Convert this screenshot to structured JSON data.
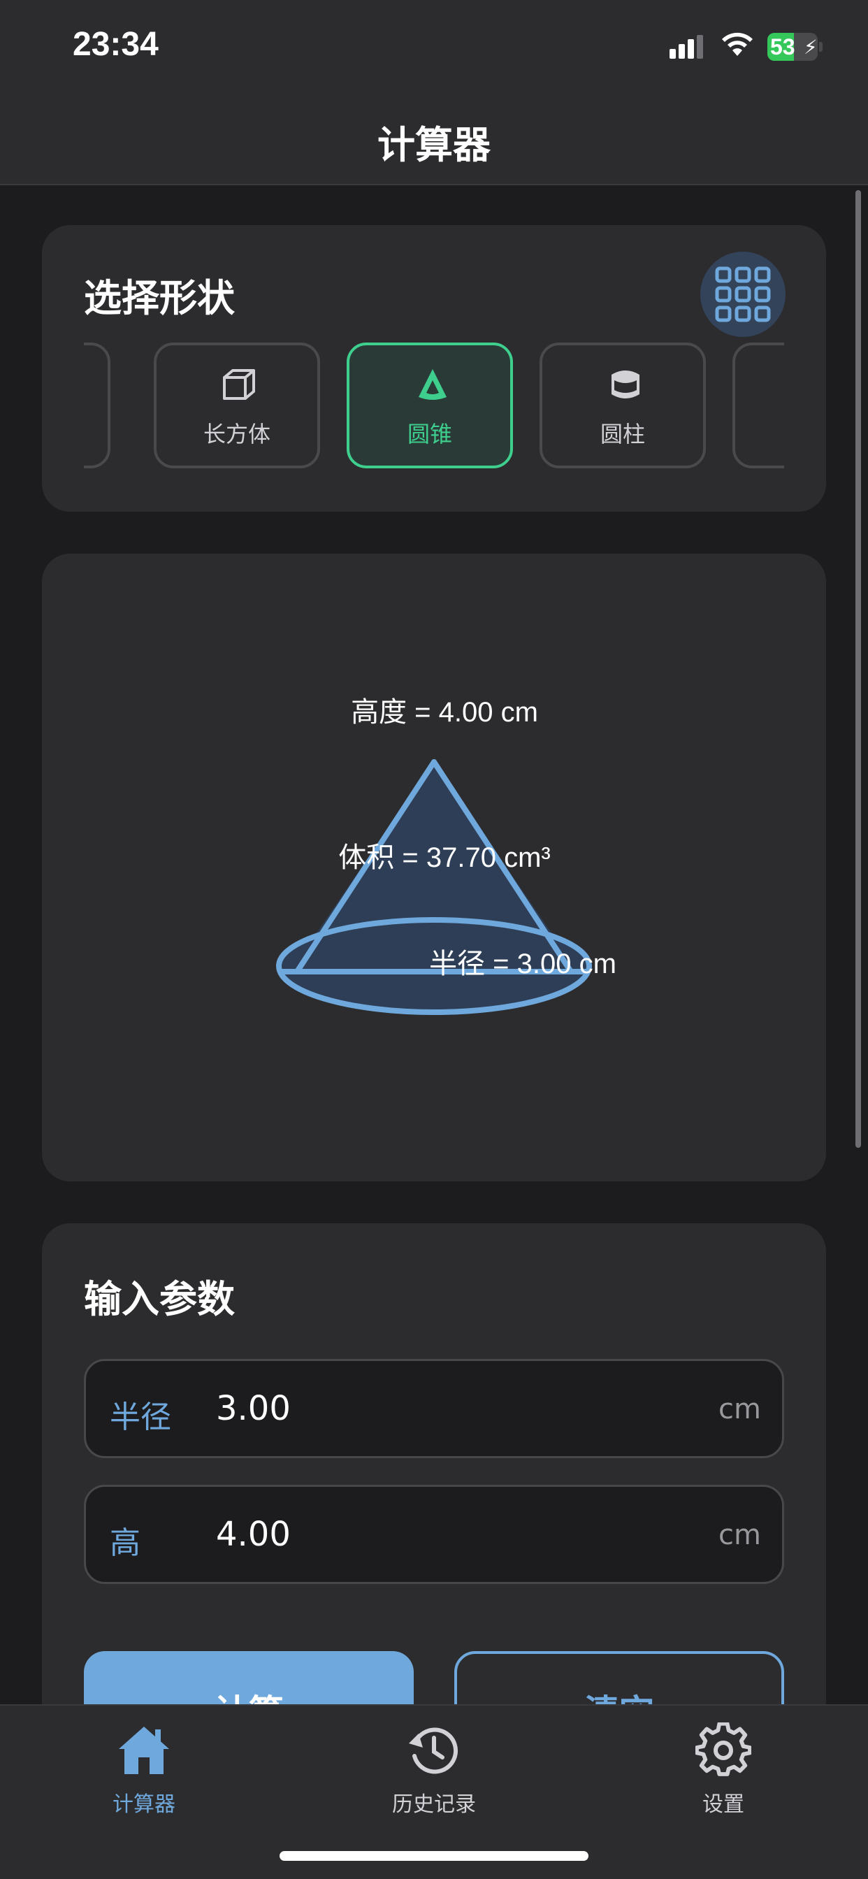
{
  "status_bar": {
    "time": "23:34",
    "battery": 53
  },
  "nav": {
    "title": "计算器"
  },
  "shape_select": {
    "title": "选择形状",
    "shapes": [
      {
        "label": "长方体",
        "icon": "cuboid-icon"
      },
      {
        "label": "圆锥",
        "icon": "cone-icon",
        "selected": true
      },
      {
        "label": "圆柱",
        "icon": "cylinder-icon"
      }
    ]
  },
  "visualization": {
    "height_label": "高度 = 4.00 cm",
    "volume_label": "体积 = 37.70 cm³",
    "radius_label": "半径 = 3.00 cm"
  },
  "inputs": {
    "title": "输入参数",
    "fields": [
      {
        "label": "半径",
        "value": "3.00",
        "unit": "cm"
      },
      {
        "label": "高",
        "value": "4.00",
        "unit": "cm"
      }
    ],
    "calculate_label": "计算",
    "clear_label": "清空"
  },
  "tabs": [
    {
      "label": "计算器",
      "icon": "home-icon",
      "active": true
    },
    {
      "label": "历史记录",
      "icon": "history-icon"
    },
    {
      "label": "设置",
      "icon": "gear-icon"
    }
  ],
  "colors": {
    "accent": "#6fa8dc",
    "selected": "#3ecf8e",
    "background": "#1c1c1e",
    "card": "#2c2c2e"
  }
}
